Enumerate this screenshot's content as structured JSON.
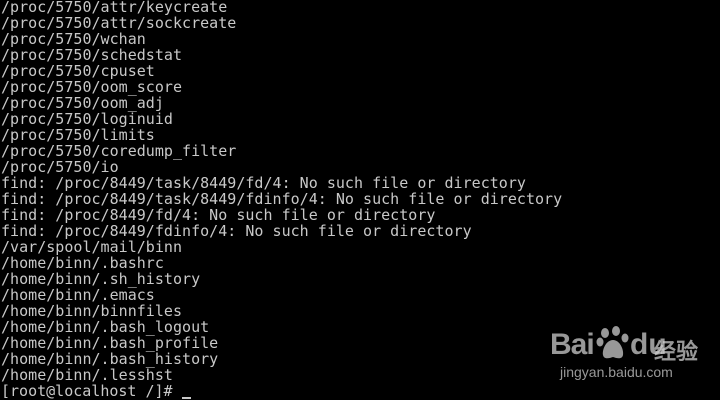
{
  "terminal": {
    "lines": [
      "/proc/5750/attr/keycreate",
      "/proc/5750/attr/sockcreate",
      "/proc/5750/wchan",
      "/proc/5750/schedstat",
      "/proc/5750/cpuset",
      "/proc/5750/oom_score",
      "/proc/5750/oom_adj",
      "/proc/5750/loginuid",
      "/proc/5750/limits",
      "/proc/5750/coredump_filter",
      "/proc/5750/io",
      "find: /proc/8449/task/8449/fd/4: No such file or directory",
      "find: /proc/8449/task/8449/fdinfo/4: No such file or directory",
      "find: /proc/8449/fd/4: No such file or directory",
      "find: /proc/8449/fdinfo/4: No such file or directory",
      "/var/spool/mail/binn",
      "/home/binn/.bashrc",
      "/home/binn/.sh_history",
      "/home/binn/.emacs",
      "/home/binn/binnfiles",
      "/home/binn/.bash_logout",
      "/home/binn/.bash_profile",
      "/home/binn/.bash_history",
      "/home/binn/.lesshst"
    ],
    "prompt": "[root@localhost /]# "
  },
  "watermark": {
    "brand_bai": "Bai",
    "brand_du": "du",
    "brand_jingyan": "经验",
    "url": "jingyan.baidu.com",
    "paw_icon": "baidu-paw-icon"
  },
  "colors": {
    "background": "#000000",
    "text": "#c8c8c8"
  }
}
